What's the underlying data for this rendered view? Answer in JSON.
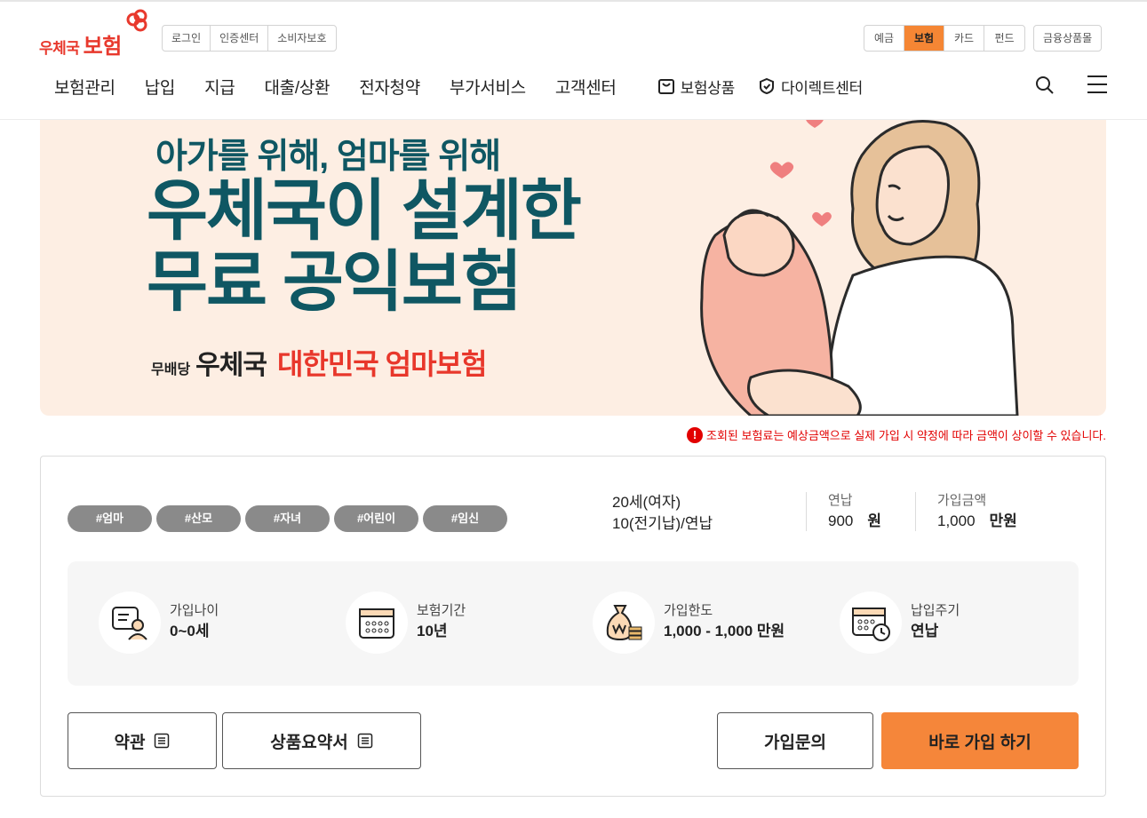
{
  "header": {
    "logo": {
      "small": "우체국",
      "big": "보험"
    },
    "utility_links": [
      "로그인",
      "인증센터",
      "소비자보호"
    ],
    "service_tabs": [
      {
        "label": "예금",
        "active": false
      },
      {
        "label": "보험",
        "active": true
      },
      {
        "label": "카드",
        "active": false
      },
      {
        "label": "펀드",
        "active": false
      }
    ],
    "financial_mall": "금융상품몰",
    "nav": [
      "보험관리",
      "납입",
      "지급",
      "대출/상환",
      "전자청약",
      "부가서비스",
      "고객센터"
    ],
    "nav_special": [
      {
        "label": "보험상품",
        "icon": "shopping-bag-icon"
      },
      {
        "label": "다이렉트센터",
        "icon": "shield-check-icon"
      }
    ]
  },
  "banner": {
    "subtitle": "아가를 위해, 엄마를 위해",
    "title_line1": "우체국이 설계한",
    "title_line2": "무료 공익보험",
    "product_prefix": "무배당",
    "product_brand": "우체국",
    "product_name": "대한민국 엄마보험"
  },
  "notice": "조회된 보험료는 예상금액으로 실제 가입 시 약정에 따라 금액이 상이할 수 있습니다.",
  "product": {
    "tags": [
      "#엄마",
      "#산모",
      "#자녀",
      "#어린이",
      "#임신"
    ],
    "summary_line1": "20세(여자)",
    "summary_line2": "10(전기납)/연납",
    "annual": {
      "label": "연납",
      "value": "900",
      "unit": "원"
    },
    "amount": {
      "label": "가입금액",
      "value": "1,000",
      "unit": "만원"
    },
    "info": [
      {
        "label": "가입나이",
        "value": "0~0세",
        "icon": "consult-person-icon"
      },
      {
        "label": "보험기간",
        "value": "10년",
        "icon": "calendar-icon"
      },
      {
        "label": "가입한도",
        "value": "1,000 - 1,000 만원",
        "icon": "money-bag-icon"
      },
      {
        "label": "납입주기",
        "value": "연납",
        "icon": "calendar-clock-icon"
      }
    ],
    "buttons": {
      "terms": "약관",
      "summary_doc": "상품요약서",
      "inquiry": "가입문의",
      "join": "바로 가입 하기"
    }
  },
  "colors": {
    "accent": "#f58634",
    "banner_bg": "#fdeee3",
    "banner_text": "#0f5763",
    "brand_red": "#e8392d",
    "notice_red": "#e20000"
  }
}
